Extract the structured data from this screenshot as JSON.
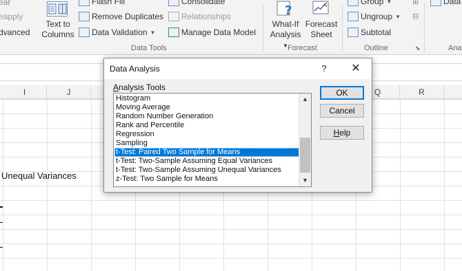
{
  "ribbon": {
    "left_fragments": {
      "top": "ear",
      "mid": "eapply",
      "bottom": "dvanced"
    },
    "text_to_columns": {
      "line1": "Text to",
      "line2": "Columns"
    },
    "flash_fill": "Flash Fill",
    "remove_duplicates": "Remove Duplicates",
    "data_validation": "Data Validation",
    "consolidate": "Consolidate",
    "relationships": "Relationships",
    "manage_data_model": "Manage Data Model",
    "data_tools_label": "Data Tools",
    "what_if": {
      "line1": "What-If",
      "line2": "Analysis"
    },
    "forecast_sheet": {
      "line1": "Forecast",
      "line2": "Sheet"
    },
    "forecast_label": "Forecast",
    "group": "Group",
    "ungroup": "Ungroup",
    "subtotal": "Subtotal",
    "outline_label": "Outline",
    "right_fragment_top": "Data",
    "right_fragment_label": "Ana"
  },
  "grid": {
    "columns": [
      "I",
      "J",
      "Q",
      "R"
    ],
    "cell_text": "Unequal Variances"
  },
  "dialog": {
    "title": "Data Analysis",
    "help_glyph": "?",
    "close_glyph": "✕",
    "tools_label_underlined": "A",
    "tools_label_rest": "nalysis Tools",
    "tools": [
      "Histogram",
      "Moving Average",
      "Random Number Generation",
      "Rank and Percentile",
      "Regression",
      "Sampling",
      "t-Test: Paired Two Sample for Means",
      "t-Test: Two-Sample Assuming Equal Variances",
      "t-Test: Two-Sample Assuming Unequal Variances",
      "z-Test: Two Sample for Means"
    ],
    "selected_tool": "t-Test: Paired Two Sample for Means",
    "ok_label": "OK",
    "cancel_label": "Cancel",
    "help_underlined": "H",
    "help_rest": "elp"
  },
  "colors": {
    "selection": "#0078d7",
    "ribbon_bg": "#f3f3f3",
    "dialog_bg": "#f0f0f0"
  }
}
